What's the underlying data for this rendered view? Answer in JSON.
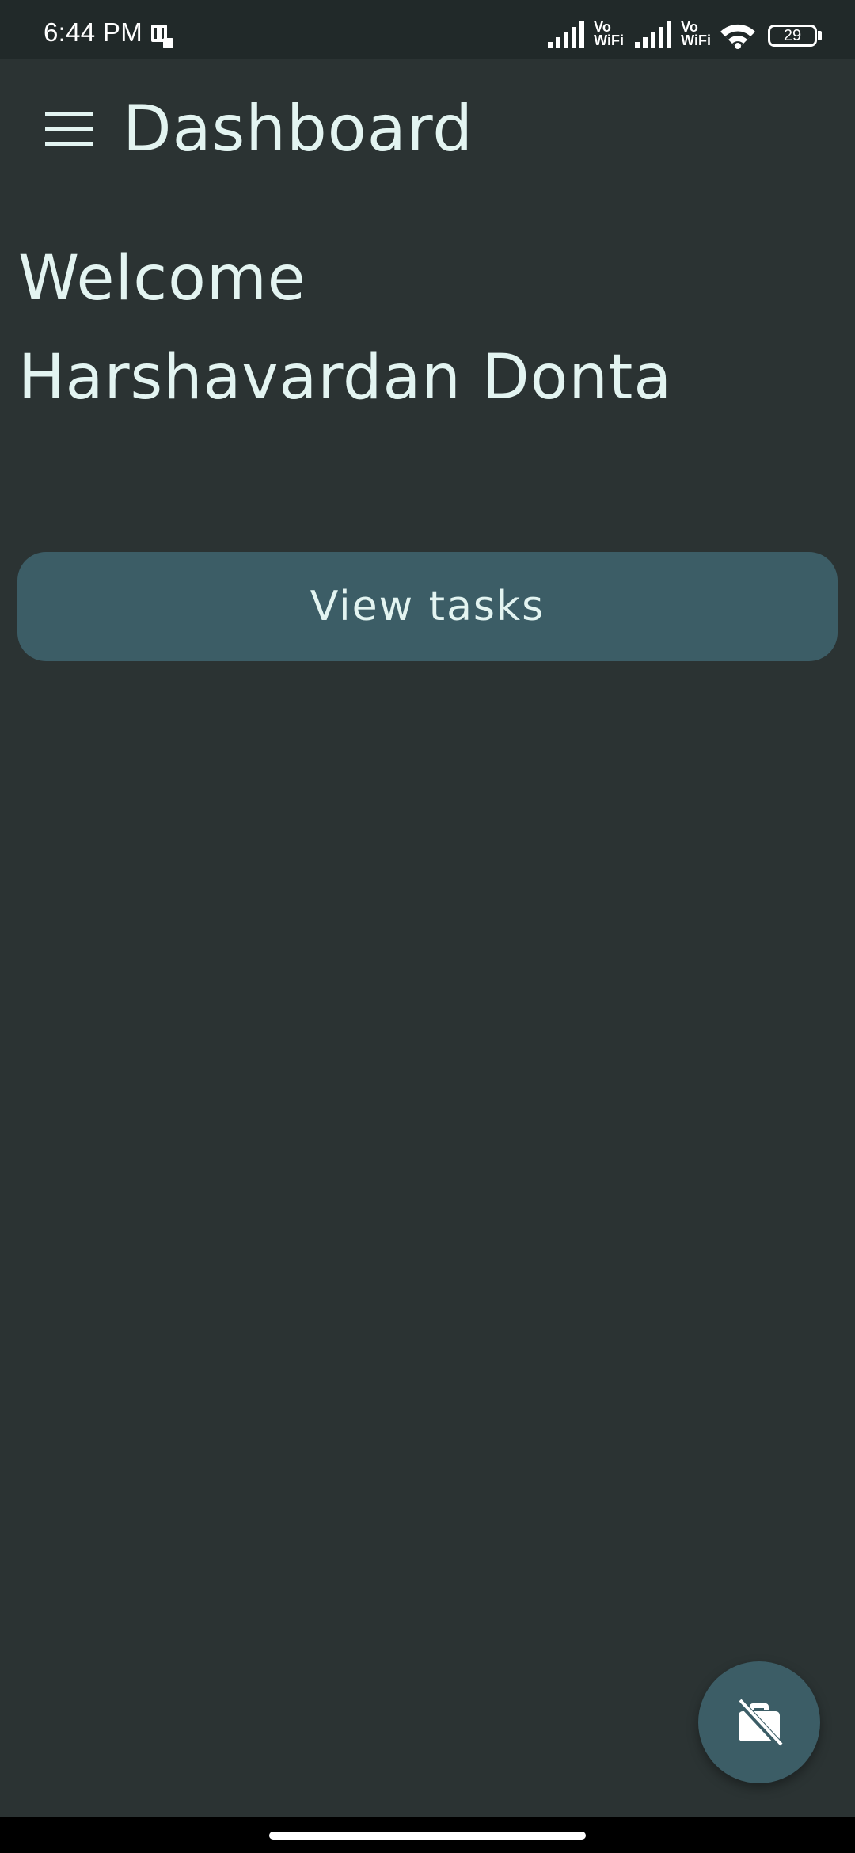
{
  "status_bar": {
    "time": "6:44 PM",
    "vo_label": "Vo",
    "wifi_label": "WiFi",
    "battery_level": "29",
    "icons": [
      "sim-card-icon",
      "signal-icon",
      "vowifi-icon",
      "wifi-icon",
      "battery-icon"
    ]
  },
  "app_bar": {
    "title": "Dashboard",
    "menu_icon": "menu-icon"
  },
  "main": {
    "welcome_line": "Welcome",
    "user_name": "Harshavardan Donta",
    "view_tasks_label": "View tasks"
  },
  "fab": {
    "icon": "briefcase-off-icon"
  },
  "colors": {
    "background": "#2b3333",
    "status_bar": "#212929",
    "accent": "#3c5d66",
    "text": "#e3f4f1"
  }
}
